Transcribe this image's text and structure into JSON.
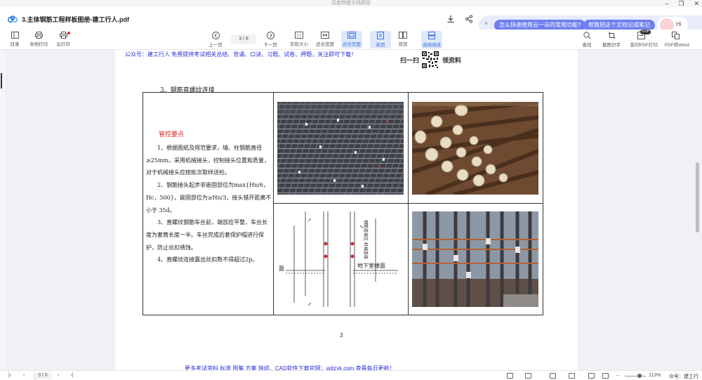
{
  "window": {
    "title": "百度网盘文档预览",
    "controls": [
      "–",
      "❐",
      "✕"
    ]
  },
  "header": {
    "file_name": "3.主体钢筋工程样板图册-建工行人.pdf",
    "ai": {
      "close": "×",
      "pill1": "怎么快速使用云一朵的常用功能?",
      "pill2": "帮我把这个文档记成笔记",
      "greeting": "Hi",
      "accent_color": "#6f7ef0"
    }
  },
  "toolbar": {
    "catalog": "目录",
    "local_print": "本地打印",
    "cloud_print": "云打印",
    "prev_page": "上一页",
    "page_indicator": "3 / 6",
    "next_page": "下一页",
    "actual_size": "实际大小",
    "fit_width": "适合宽度",
    "fit_page": "适合页面",
    "single_page": "单页",
    "double_page": "双页",
    "continuous": "连续阅读",
    "search": "查找",
    "screenshot_ocr": "截图识字",
    "scan_pdf": "影印PDF打印",
    "pro_badge": "SVIP",
    "pdf_to_word": "PDF转Word",
    "active_color": "#3a6fd8"
  },
  "document": {
    "header_text": "公众号：建工行人 免费提供考试相关总结、背诵、口诀、习题、试卷、押题，关注即可下载！",
    "qr_left": "扫一扫",
    "qr_right": "领资料",
    "section_title": "3、钢筋直螺纹连接",
    "mgmt_title": "管控要点",
    "points": [
      "1、根据图纸及规范要求，墙、柱钢筋直径≥25mm，采用机械接头，控制接头位置和质量，对于机械接头应按批次取样送检。",
      "2、钢筋接头起步非嵌固部位为max{Hn/6，Hc，500}，嵌固部位为≥Hn/3，接头错开距离不小于 35d。",
      "3、直螺纹钢筋车丝前，端部应平整，车丝长度为套筒长度一半。车丝完成后套保护帽进行保护，防止丝扣锈蚀。",
      "4、直螺纹连接露出丝扣数不得超过2p。"
    ],
    "page_number": "3",
    "footer_text": "更多考试资料 标准 图集 方案 施组、CAD软件下载官网：wdzyk.com 查看每日更新！",
    "drawing_labels": {
      "floor": "面",
      "basement": "地下室楼面",
      "note": "钢筋连接区 机械连接"
    }
  },
  "statusbar": {
    "page": "3 / 6",
    "zoom": "113%",
    "watermark": "众号：建工行人"
  }
}
